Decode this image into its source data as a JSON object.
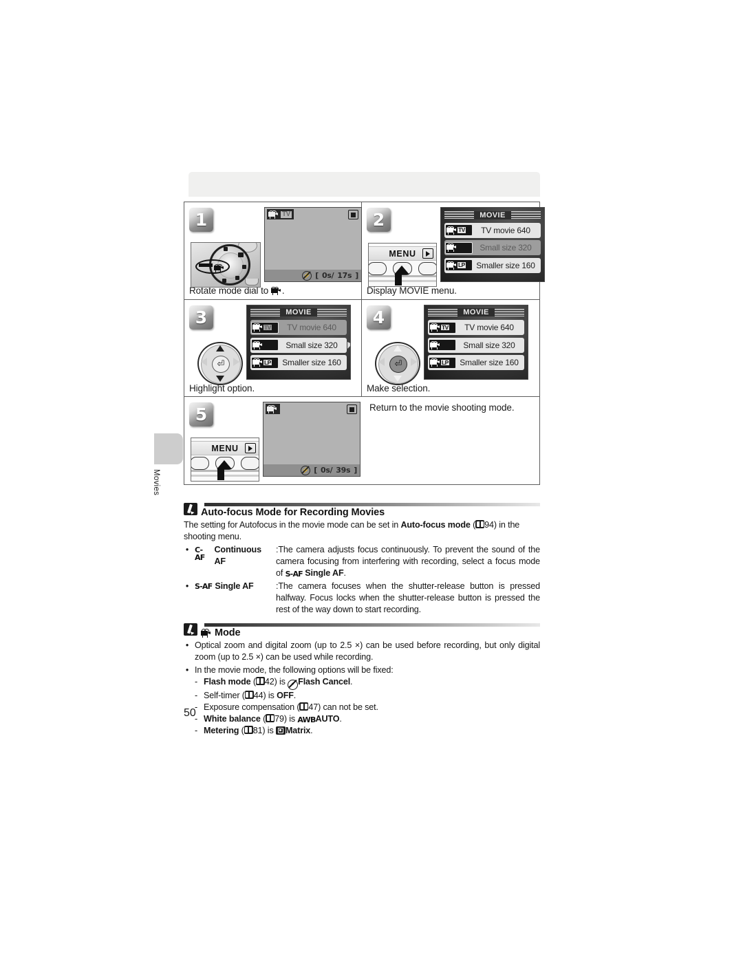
{
  "page": {
    "number": "50",
    "side_tab_label": "Movies"
  },
  "steps": [
    {
      "number": "1",
      "caption_before": "Rotate mode dial to",
      "caption_after": ".",
      "caption_icon": "movie-camera-icon",
      "lcd": {
        "mode_tag": "TV",
        "time_elapsed": "0s/",
        "time_remaining": "17s",
        "bracket": "[",
        "close_bracket": "]"
      }
    },
    {
      "number": "2",
      "caption": "Display MOVIE menu.",
      "button_label": "MENU",
      "menu": {
        "title": "MOVIE",
        "items": [
          {
            "tag": "TV",
            "label": "TV movie 640",
            "state": "bright"
          },
          {
            "tag": "",
            "label": "Small size 320",
            "state": "dim"
          },
          {
            "tag": "LP",
            "label": "Smaller size 160",
            "state": "bright"
          }
        ]
      }
    },
    {
      "number": "3",
      "caption": "Highlight option.",
      "menu": {
        "title": "MOVIE",
        "items": [
          {
            "tag": "TV",
            "label": "TV movie 640",
            "state": "dim"
          },
          {
            "tag": "",
            "label": "Small size 320",
            "state": "bright"
          },
          {
            "tag": "LP",
            "label": "Smaller size 160",
            "state": "bright"
          }
        ]
      }
    },
    {
      "number": "4",
      "caption": "Make selection.",
      "menu": {
        "title": "MOVIE",
        "items": [
          {
            "tag": "TV",
            "label": "TV movie 640",
            "state": "bright"
          },
          {
            "tag": "",
            "label": "Small size 320",
            "state": "bright"
          },
          {
            "tag": "LP",
            "label": "Smaller size 160",
            "state": "bright"
          }
        ]
      }
    },
    {
      "number": "5",
      "caption": "Return to the movie shooting mode.",
      "button_label": "MENU",
      "lcd": {
        "time_elapsed": "0s/",
        "time_remaining": "39s",
        "bracket": "[",
        "close_bracket": "]"
      }
    }
  ],
  "notes": [
    {
      "title": "Auto-focus Mode for Recording Movies",
      "intro_a": "The setting for Autofocus in the movie mode can be set in ",
      "intro_b": "Auto-focus mode",
      "intro_ref": "94",
      "intro_c": ") in the shooting menu.",
      "bullets": [
        {
          "icon": "C-AF",
          "term": "Continuous AF",
          "sep": ":",
          "def_a": "The camera adjusts focus continuously. To prevent the sound of the camera focusing from interfering with recording, select a focus mode of ",
          "def_icon": "S-AF",
          "def_b": "Single AF",
          "def_c": "."
        },
        {
          "icon": "S-AF",
          "term": "Single AF",
          "sep": ":",
          "def_a": "The camera focuses when the shutter-release button is pressed halfway. Focus locks when the shutter-release button is pressed the rest of the way down to start recording.",
          "def_icon": "",
          "def_b": "",
          "def_c": ""
        }
      ]
    },
    {
      "title": "Mode",
      "title_icon": "movie-camera-icon",
      "bullets": [
        "Optical zoom and digital zoom (up to 2.5 ×) can be used before recording, but only digital zoom (up to 2.5 ×) can be used while recording.",
        "In the movie mode, the following options will be fixed:"
      ],
      "fixed_options": [
        {
          "label": "Flash mode",
          "bold_label": true,
          "ref": "42",
          "mid": ") is ",
          "icon": "flash-cancel-icon",
          "value": "Flash Cancel",
          "bold_value": true,
          "end": "."
        },
        {
          "label": "Self-timer",
          "bold_label": false,
          "ref": "44",
          "mid": ") is ",
          "icon": "",
          "value": "OFF",
          "bold_value": true,
          "end": "."
        },
        {
          "label": "Exposure compensation",
          "bold_label": false,
          "ref": "47",
          "mid": ") can not be set.",
          "icon": "",
          "value": "",
          "bold_value": false,
          "end": ""
        },
        {
          "label": "White balance",
          "bold_label": true,
          "ref": "79",
          "mid": ") is ",
          "icon": "AWB",
          "value": "AUTO",
          "bold_value": true,
          "end": "."
        },
        {
          "label": "Metering",
          "bold_label": true,
          "ref": "81",
          "mid": ") is ",
          "icon": "matrix-icon",
          "value": "Matrix",
          "bold_value": true,
          "end": "."
        }
      ]
    }
  ]
}
